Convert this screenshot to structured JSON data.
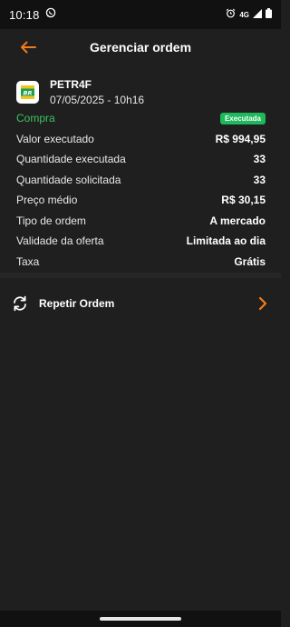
{
  "status_bar": {
    "time": "10:18",
    "network": "4G",
    "icons": [
      "whatsapp-icon",
      "alarm-icon",
      "signal-icon",
      "battery-icon"
    ]
  },
  "header": {
    "title": "Gerenciar ordem",
    "back_icon": "arrow-left-icon"
  },
  "asset": {
    "ticker": "PETR4F",
    "datetime": "07/05/2025 - 10h16",
    "logo_text": "BR"
  },
  "order": {
    "side": "Compra",
    "status": "Executada",
    "rows": [
      {
        "label": "Valor executado",
        "value": "R$ 994,95"
      },
      {
        "label": "Quantidade executada",
        "value": "33"
      },
      {
        "label": "Quantidade solicitada",
        "value": "33"
      },
      {
        "label": "Preço médio",
        "value": "R$ 30,15"
      },
      {
        "label": "Tipo de ordem",
        "value": "A mercado"
      },
      {
        "label": "Validade da oferta",
        "value": "Limitada ao dia"
      },
      {
        "label": "Taxa",
        "value": "Grátis"
      }
    ]
  },
  "actions": {
    "repeat_label": "Repetir Ordem",
    "repeat_icon": "refresh-icon",
    "chevron_icon": "chevron-right-icon"
  },
  "colors": {
    "accent": "#f07c1a",
    "green": "#3cc35f",
    "badge": "#1fb85a",
    "background": "#1f1f1f"
  }
}
